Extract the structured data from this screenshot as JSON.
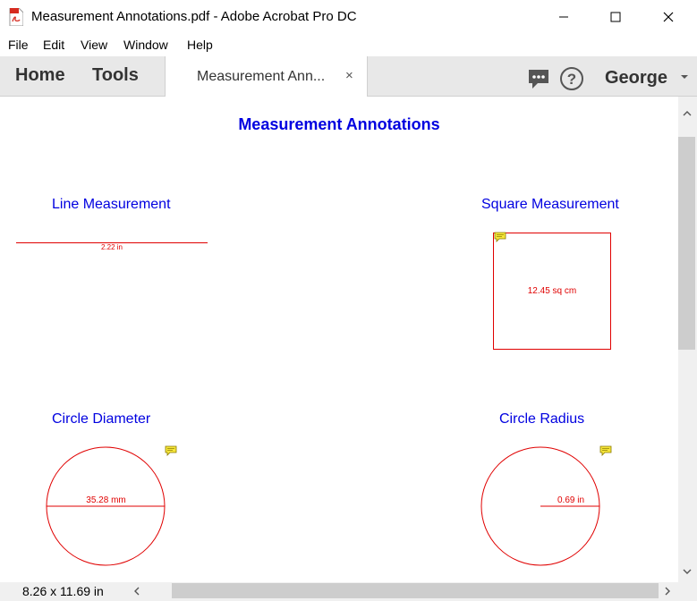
{
  "window": {
    "title": "Measurement Annotations.pdf - Adobe Acrobat Pro DC"
  },
  "menu": [
    "File",
    "Edit",
    "View",
    "Window",
    "Help"
  ],
  "toolbar": {
    "home_label": "Home",
    "tools_label": "Tools",
    "document_tab_label": "Measurement Ann...",
    "close_tab_glyph": "×",
    "user_name": "George"
  },
  "document": {
    "title": "Measurement Annotations",
    "sections": {
      "line": {
        "heading": "Line Measurement",
        "value": "2.22 in"
      },
      "square": {
        "heading": "Square Measurement",
        "value": "12.45 sq cm"
      },
      "circle_diameter": {
        "heading": "Circle Diameter",
        "value": "35.28 mm"
      },
      "circle_radius": {
        "heading": "Circle Radius",
        "value": "0.69 in"
      }
    }
  },
  "status": {
    "page_size": "8.26 x 11.69 in"
  },
  "colors": {
    "heading_blue": "#0000e0",
    "annotation_red": "#e00000",
    "note_yellow": "#f5e53a"
  }
}
